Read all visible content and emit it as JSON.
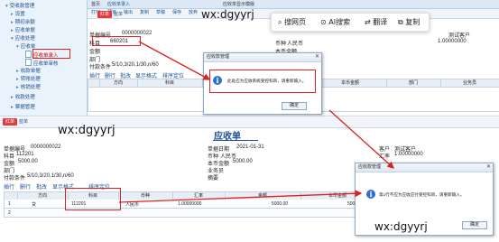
{
  "top": {
    "sidebar": {
      "items": [
        {
          "label": "受收款管理"
        },
        {
          "label": "设置"
        },
        {
          "label": "期初余额"
        },
        {
          "label": "应收单据"
        },
        {
          "label": "应收处理"
        },
        {
          "label": "应收单"
        },
        {
          "label": "应收单录入"
        },
        {
          "label": "应收单审核"
        },
        {
          "label": "收款单据"
        },
        {
          "label": "转账处理"
        },
        {
          "label": "核销处理"
        },
        {
          "label": "收款处理"
        },
        {
          "label": "票据管理"
        }
      ]
    },
    "topbar": {
      "tab_home": "首页",
      "tab_doc": "应收单录入",
      "tab_display": "应收单显示模版"
    },
    "toolbar": {
      "print": "打印",
      "preview": "预览",
      "output": "输出",
      "copy": "复制",
      "draft": "草稿",
      "save": "保存",
      "give_up": "放弃"
    },
    "doc_tabs": {
      "red": "红单",
      "blue": "蓝单"
    },
    "watermark": "wx:dgyyrj",
    "form": {
      "doc_no_label": "单据编号",
      "doc_no": "0000000022",
      "subject_label": "科目",
      "subject": "660201",
      "amount_label": "金额",
      "dept_label": "部门",
      "terms_label": "付款条件",
      "terms": "5/10,3/20,1/30,n/60",
      "currency_label": "币种",
      "currency": "人民币",
      "local_label": "本币金额",
      "qty_label": "数量",
      "customer_value": "测试客户",
      "rate": "1.00000000"
    },
    "grid_toolbar": {
      "insert": "插行",
      "delete": "删行",
      "batch": "批改",
      "display": "显示格式",
      "sort": "排序定位"
    },
    "grid_headers": {
      "direction": "方向",
      "subject": "科目",
      "local_amount": "本币金额",
      "dept": "部门",
      "salesman": "业务员"
    },
    "dialog": {
      "title": "应收款管理",
      "message": "此处应为应收系统受控科目，请重新输入。",
      "ok": "确定"
    }
  },
  "popup": {
    "search_web": "搜网页",
    "ai_search": "AI搜索",
    "translate": "翻译",
    "copy": "复制"
  },
  "bottom": {
    "doc_tabs": {
      "red": "红单",
      "blue": "蓝单"
    },
    "watermark": "wx:dgyyrj",
    "title": "应收单",
    "form": {
      "doc_no_label": "单据编号",
      "doc_no": "0000000022",
      "date_label": "单据日期",
      "date": "2021-01-31",
      "customer_label": "客户",
      "customer": "测试客户",
      "subject_label": "科目",
      "subject": "112201",
      "currency_label": "币种",
      "currency": "人民币",
      "rate_label": "汇率",
      "rate": "1.00000000",
      "amount_label": "金额",
      "amount": "5000.00",
      "local_label": "本币金额",
      "local": "5000.00",
      "dept_label": "部门",
      "salesman_label": "业务员",
      "terms_label": "付款条件",
      "terms": "5/10,3/20,1/30,n/60",
      "memo_label": "摘要"
    },
    "grid_toolbar": {
      "insert": "插行",
      "delete": "删行",
      "batch": "批改",
      "display": "显示格式",
      "sort": "排序定位"
    },
    "grid_headers": {
      "direction": "方向",
      "subject": "科目",
      "currency": "币种",
      "rate": "汇率",
      "amount": "金额",
      "local_amount": "本币金额"
    },
    "row": {
      "num": "1",
      "direction": "贷",
      "subject": "112201",
      "currency": "人民币",
      "rate": "1.00000000",
      "amount": "5000.00",
      "local_amount": "5000.00"
    },
    "row2": {
      "num": "2"
    },
    "dialog": {
      "title": "应收款管理",
      "message": "第1行不应为应收应付受控科目，请重新输入。",
      "ok": "确定"
    }
  }
}
